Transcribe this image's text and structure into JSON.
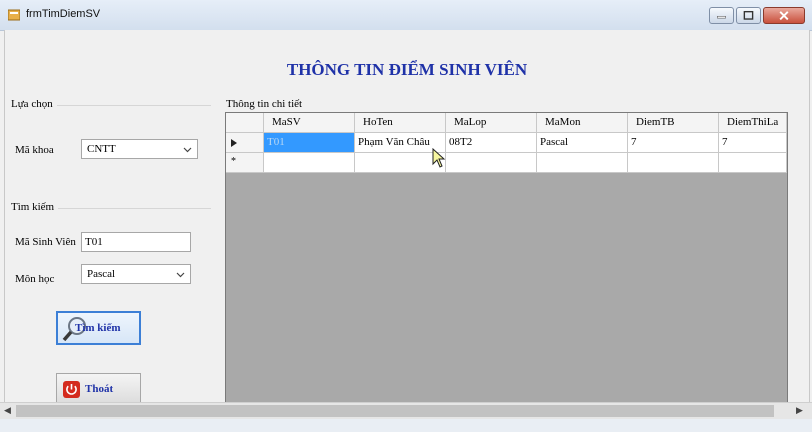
{
  "window": {
    "title": "frmTimDiemSV"
  },
  "heading": "THÔNG TIN ĐIỂM SINH VIÊN",
  "group_select": {
    "caption": "Lựa chọn",
    "faculty_label": "Mã khoa",
    "faculty_value": "CNTT"
  },
  "group_search": {
    "caption": "Tìm kiếm",
    "student_id_label": "Mã Sinh Viên",
    "student_id_value": "T01",
    "subject_label": "Môn học",
    "subject_value": "Pascal",
    "search_button": "Tìm kiếm",
    "exit_button": "Thoát"
  },
  "grid": {
    "caption": "Thông tin chi tiết",
    "columns": [
      "MaSV",
      "HoTen",
      "MaLop",
      "MaMon",
      "DiemTB",
      "DiemThiLa"
    ],
    "rows": [
      [
        "T01",
        "Phạm Văn Châu",
        "08T2",
        "Pascal",
        "7",
        "7"
      ]
    ],
    "new_row_marker": "*"
  },
  "icons": {
    "app": "form-icon",
    "combo_arrow": "chevron-down-icon",
    "search": "magnifier-icon",
    "exit": "power-icon",
    "row_pointer": "row-pointer-icon"
  },
  "colors": {
    "heading": "#1f32a8",
    "selection": "#3399ff",
    "grid_background": "#a9a9a9"
  }
}
